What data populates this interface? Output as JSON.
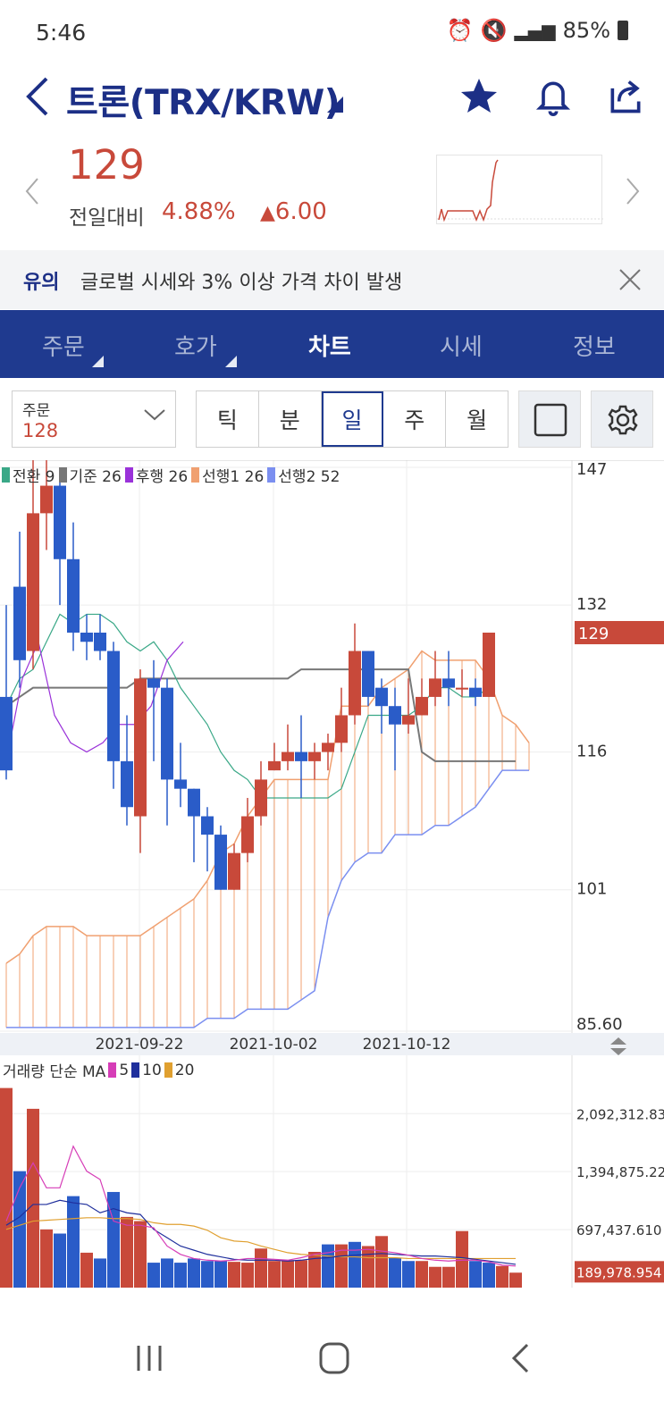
{
  "status": {
    "time": "5:46",
    "battery": "85%"
  },
  "header": {
    "title": "트론(TRX/KRW)"
  },
  "price": {
    "current": "129",
    "prev_label": "전일대비",
    "change_pct": "4.88%",
    "change_abs": "6.00"
  },
  "notice": {
    "tag": "유의",
    "text": "글로벌 시세와 3% 이상 가격 차이 발생"
  },
  "tabs": [
    {
      "label": "주문",
      "active": false,
      "corner": true
    },
    {
      "label": "호가",
      "active": false,
      "corner": true
    },
    {
      "label": "차트",
      "active": true,
      "corner": false
    },
    {
      "label": "시세",
      "active": false,
      "corner": false
    },
    {
      "label": "정보",
      "active": false,
      "corner": false
    }
  ],
  "order_select": {
    "label": "주문",
    "value": "128"
  },
  "periods": [
    {
      "label": "틱",
      "active": false
    },
    {
      "label": "분",
      "active": false
    },
    {
      "label": "일",
      "active": true
    },
    {
      "label": "주",
      "active": false
    },
    {
      "label": "월",
      "active": false
    }
  ],
  "legend": [
    {
      "label": "전환 9",
      "color": "#3aa887"
    },
    {
      "label": "기준 26",
      "color": "#777777"
    },
    {
      "label": "후행 26",
      "color": "#9a32d9"
    },
    {
      "label": "선행1 26",
      "color": "#f0a070"
    },
    {
      "label": "선행2 52",
      "color": "#7b8ff0"
    }
  ],
  "volume_legend": {
    "prefix": "거래량 단순 MA",
    "items": [
      {
        "label": "5",
        "color": "#d63db7"
      },
      {
        "label": "10",
        "color": "#1f2f9c"
      },
      {
        "label": "20",
        "color": "#e0a030"
      }
    ]
  },
  "chart_data": [
    {
      "type": "candlestick",
      "indicator": "ichimoku",
      "y_ticks": [
        "147",
        "132",
        "116",
        "101",
        "85.60"
      ],
      "last_price_label": "129",
      "x_ticks": [
        "2021-09-22",
        "2021-10-02",
        "2021-10-12"
      ],
      "ylim": [
        85.6,
        147
      ],
      "candles": [
        [
          122,
          114,
          132,
          113
        ],
        [
          134,
          126,
          140,
          123
        ],
        [
          127,
          142,
          148,
          125
        ],
        [
          142,
          145,
          149,
          138
        ],
        [
          145,
          137,
          146,
          132
        ],
        [
          137,
          129,
          141,
          127
        ],
        [
          129,
          128,
          131,
          126
        ],
        [
          129,
          127,
          131,
          126
        ],
        [
          127,
          115,
          128,
          112
        ],
        [
          115,
          110,
          120,
          108
        ],
        [
          109,
          124,
          125,
          105
        ],
        [
          124,
          123,
          126,
          115
        ],
        [
          123,
          113,
          124,
          108
        ],
        [
          113,
          112,
          117,
          110
        ],
        [
          112,
          109,
          112,
          104
        ],
        [
          109,
          107,
          110,
          103
        ],
        [
          107,
          101,
          108,
          101
        ],
        [
          101,
          105,
          106,
          101
        ],
        [
          105,
          109,
          111,
          104
        ],
        [
          109,
          113,
          115,
          108
        ],
        [
          114,
          115,
          117,
          114
        ],
        [
          115,
          116,
          119,
          114
        ],
        [
          116,
          115,
          120,
          111
        ],
        [
          115,
          116,
          117,
          113
        ],
        [
          116,
          117,
          118,
          114
        ],
        [
          117,
          120,
          123,
          116
        ],
        [
          120,
          127,
          130,
          119
        ],
        [
          127,
          122,
          127,
          121
        ],
        [
          123,
          121,
          124,
          118
        ],
        [
          121,
          119,
          123,
          114
        ],
        [
          119,
          120,
          124,
          118
        ],
        [
          120,
          122,
          124,
          120
        ],
        [
          122,
          124,
          127,
          121
        ],
        [
          124,
          123,
          127,
          121
        ],
        [
          123,
          123,
          125,
          122
        ],
        [
          123,
          122,
          124,
          121
        ],
        [
          122,
          129,
          129,
          122
        ]
      ],
      "conversion_9": [
        121,
        124,
        125,
        128,
        131,
        130,
        131,
        131,
        130,
        128,
        127,
        128,
        126,
        123,
        121,
        119,
        116,
        114,
        113,
        111,
        111,
        111,
        111,
        111,
        111,
        112,
        116,
        120,
        120,
        120,
        120,
        121,
        123,
        123,
        122,
        122,
        123
      ],
      "base_26": [
        121,
        122,
        123,
        123,
        123,
        123,
        123,
        123,
        123,
        123,
        124,
        124,
        124,
        124,
        124,
        124,
        124,
        124,
        124,
        124,
        124,
        124,
        125,
        125,
        125,
        125,
        125,
        125,
        125,
        125,
        125,
        116,
        115,
        115,
        115,
        115,
        115,
        115,
        115
      ],
      "lagging_26": [
        115,
        124,
        128,
        120,
        117,
        116,
        117,
        119,
        119,
        121,
        126,
        128
      ],
      "span1": [
        93,
        94,
        96,
        97,
        97,
        97,
        96,
        96,
        96,
        96,
        96,
        97,
        98,
        99,
        100,
        102,
        105,
        106,
        109,
        111,
        113,
        113,
        113,
        113,
        113,
        121,
        121,
        121,
        123,
        124,
        125,
        127,
        126,
        126,
        126,
        126,
        124,
        120,
        119,
        117
      ],
      "span2": [
        86,
        86,
        86,
        86,
        86,
        86,
        86,
        86,
        86,
        86,
        86,
        86,
        86,
        86,
        86,
        87,
        87,
        87,
        88,
        88,
        88,
        88,
        89,
        90,
        98,
        102,
        104,
        105,
        105,
        107,
        107,
        107,
        108,
        108,
        109,
        110,
        112,
        114,
        114,
        114
      ]
    },
    {
      "type": "bar",
      "title": "거래량 단순 MA",
      "y_ticks": [
        "2,092,312.831",
        "1,394,875.221",
        "697,437.610"
      ],
      "last_value_label": "189,978.954",
      "ylim": [
        0,
        2600000
      ],
      "volumes": [
        2400000,
        1400000,
        2150000,
        700000,
        650000,
        1100000,
        420000,
        350000,
        1150000,
        850000,
        800000,
        300000,
        350000,
        300000,
        350000,
        320000,
        320000,
        310000,
        300000,
        470000,
        320000,
        330000,
        330000,
        430000,
        520000,
        520000,
        550000,
        500000,
        620000,
        360000,
        320000,
        320000,
        250000,
        250000,
        680000,
        320000,
        300000,
        260000,
        180000
      ],
      "up": [
        1,
        0,
        1,
        1,
        0,
        0,
        1,
        0,
        0,
        1,
        1,
        0,
        0,
        0,
        0,
        0,
        0,
        1,
        1,
        1,
        1,
        1,
        1,
        1,
        0,
        1,
        0,
        1,
        1,
        0,
        0,
        1,
        1,
        1,
        1,
        0,
        0,
        1,
        1
      ],
      "ma5": [
        800000,
        1200000,
        1500000,
        1200000,
        1200000,
        1700000,
        1400000,
        1300000,
        800000,
        750000,
        750000,
        720000,
        500000,
        400000,
        350000,
        330000,
        320000,
        330000,
        350000,
        350000,
        340000,
        330000,
        360000,
        400000,
        420000,
        450000,
        450000,
        460000,
        440000,
        420000,
        390000,
        350000,
        330000,
        320000,
        330000,
        330000,
        310000,
        270000,
        260000
      ],
      "ma10": [
        750000,
        850000,
        1000000,
        1000000,
        1050000,
        1020000,
        1000000,
        900000,
        950000,
        900000,
        880000,
        700000,
        600000,
        500000,
        450000,
        400000,
        370000,
        340000,
        330000,
        330000,
        330000,
        320000,
        330000,
        350000,
        360000,
        380000,
        390000,
        400000,
        410000,
        400000,
        390000,
        380000,
        380000,
        370000,
        360000,
        340000,
        320000,
        300000,
        280000
      ],
      "ma20": [
        700000,
        750000,
        800000,
        810000,
        820000,
        830000,
        840000,
        840000,
        830000,
        830000,
        820000,
        780000,
        760000,
        760000,
        740000,
        690000,
        600000,
        560000,
        550000,
        500000,
        460000,
        420000,
        400000,
        390000,
        380000,
        370000,
        370000,
        360000,
        360000,
        360000,
        350000,
        350000,
        350000,
        350000,
        350000,
        350000,
        350000,
        350000,
        350000
      ]
    }
  ]
}
